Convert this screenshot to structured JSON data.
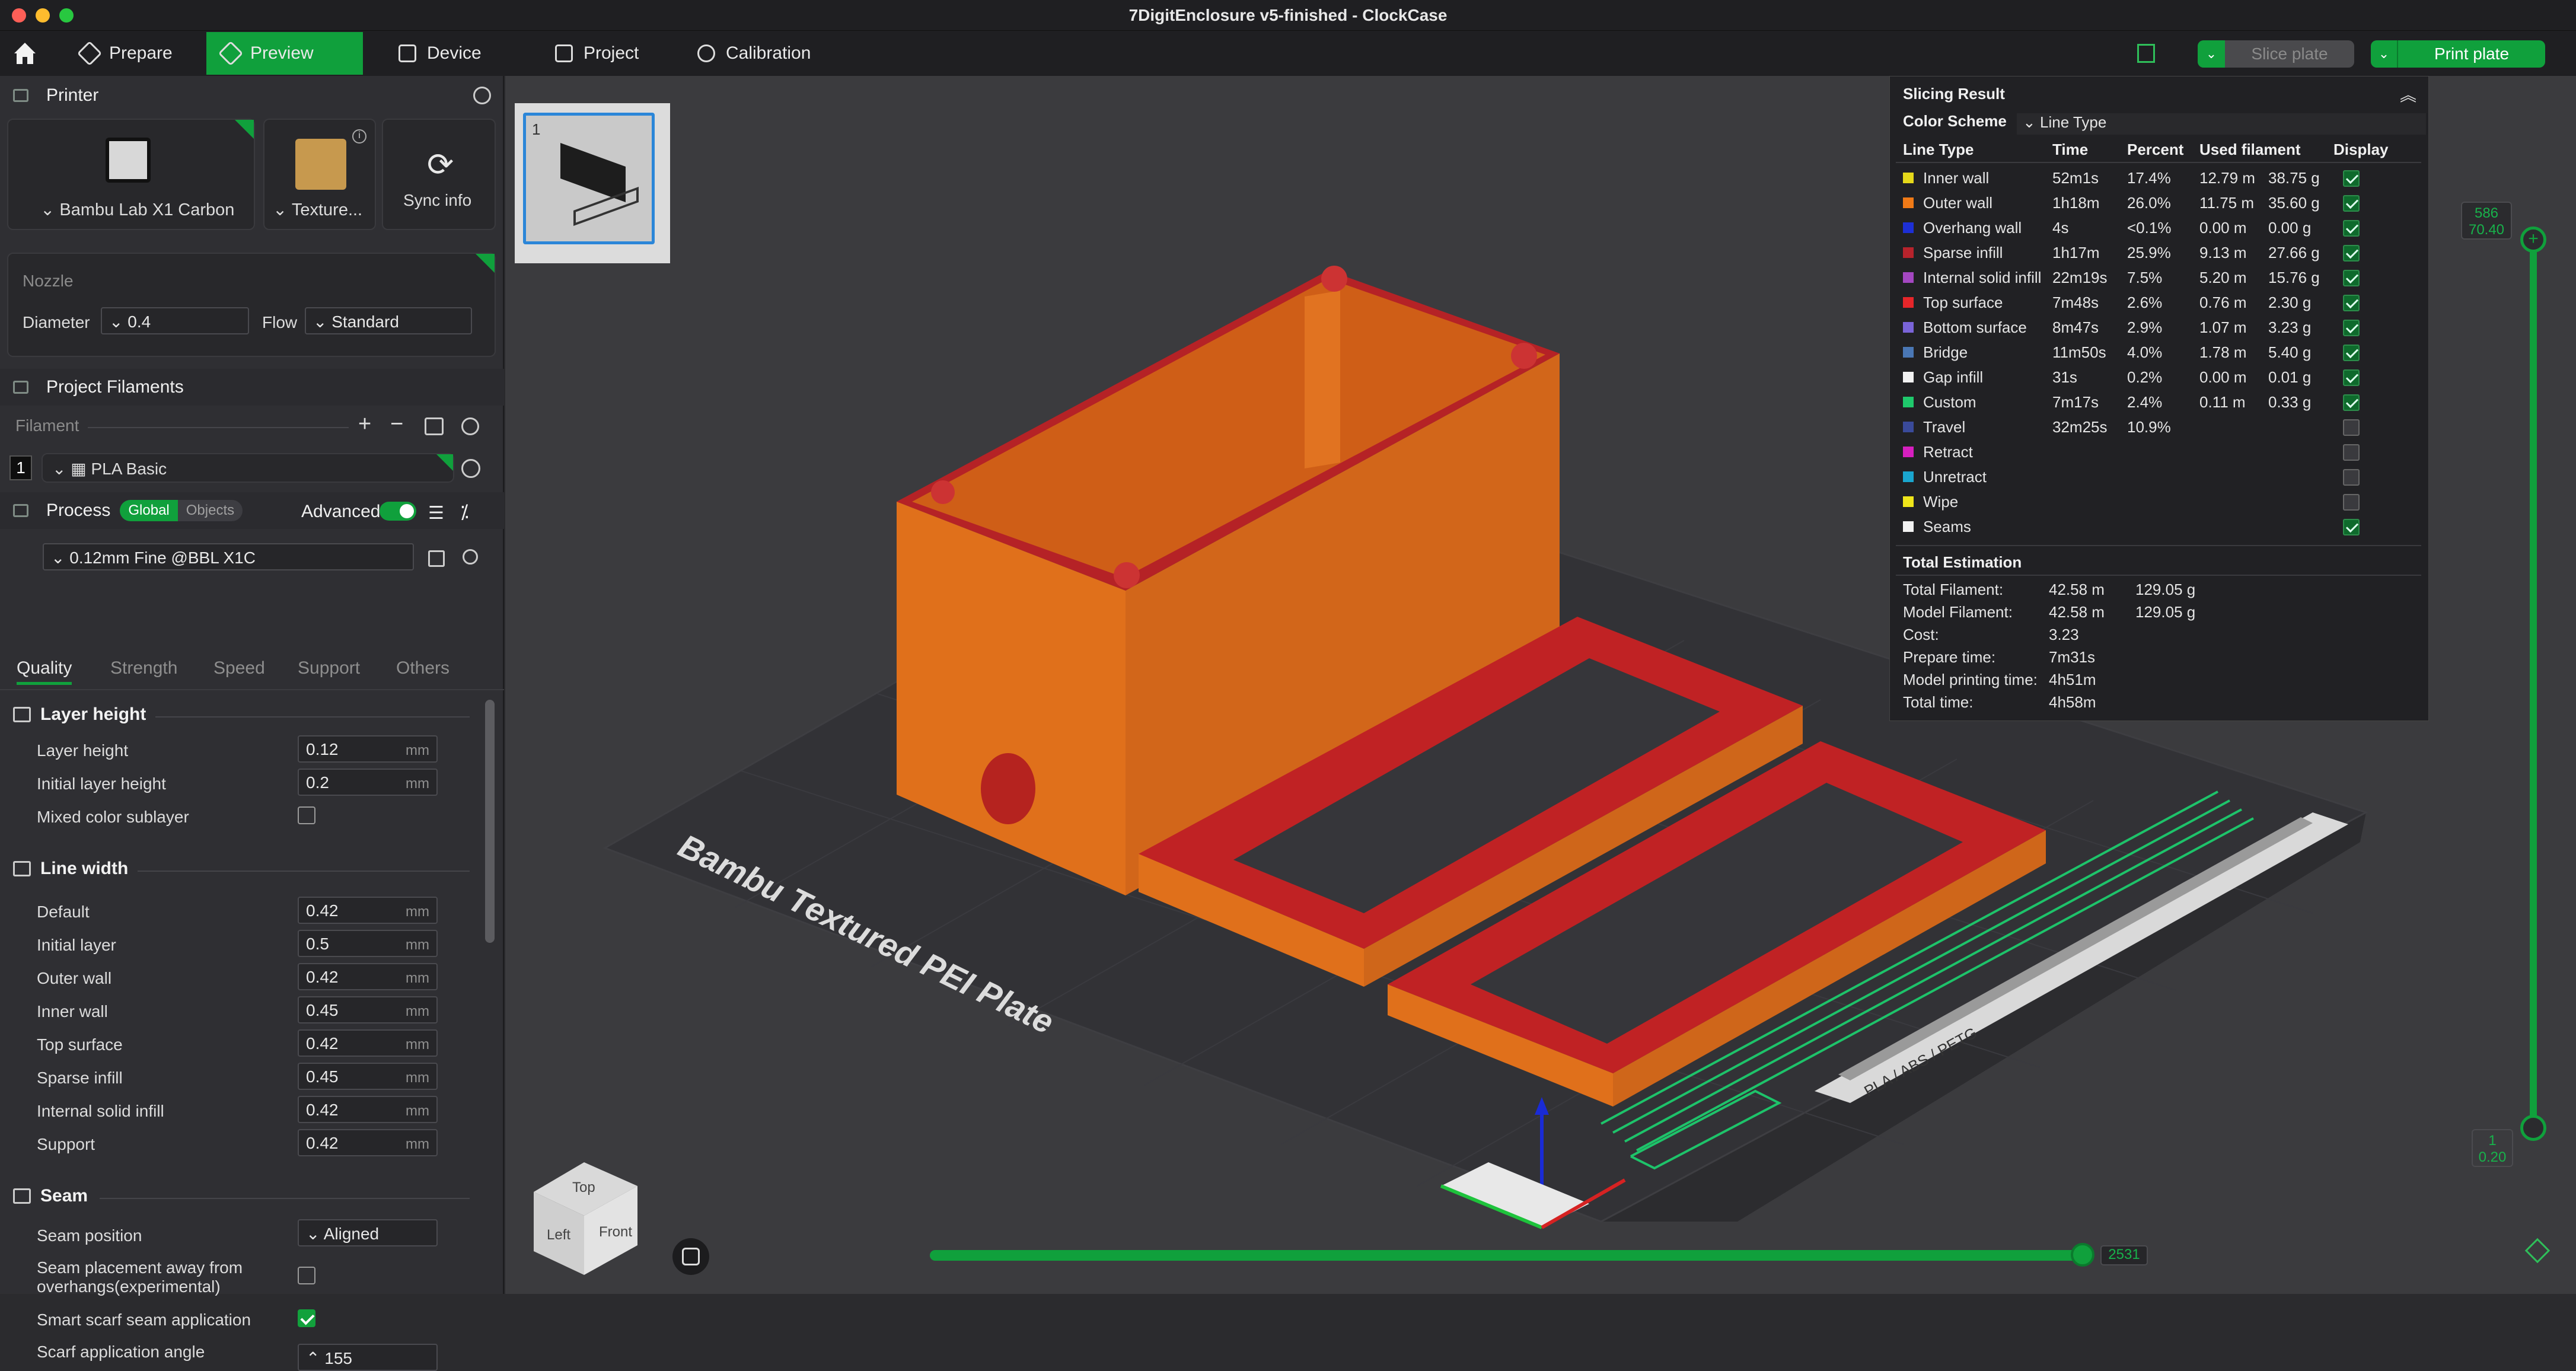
{
  "window": {
    "title": "7DigitEnclosure v5-finished - ClockCase"
  },
  "toolbar": {
    "tabs": [
      {
        "label": "Prepare"
      },
      {
        "label": "Preview"
      },
      {
        "label": "Device"
      },
      {
        "label": "Project"
      },
      {
        "label": "Calibration"
      }
    ],
    "slice_label": "Slice plate",
    "print_label": "Print plate"
  },
  "printer": {
    "section_label": "Printer",
    "printer_name": "Bambu Lab X1 Carbon",
    "plate_name": "Texture...",
    "sync_label": "Sync info",
    "nozzle_label": "Nozzle",
    "diameter_label": "Diameter",
    "diameter_value": "0.4",
    "flow_label": "Flow",
    "flow_value": "Standard"
  },
  "filaments": {
    "section_label": "Project Filaments",
    "filament_label": "Filament",
    "items": [
      {
        "index": "1",
        "name": "PLA Basic"
      }
    ]
  },
  "process": {
    "section_label": "Process",
    "global_label": "Global",
    "objects_label": "Objects",
    "advanced_label": "Advanced",
    "preset": "0.12mm Fine @BBL X1C",
    "tabs": [
      "Quality",
      "Strength",
      "Speed",
      "Support",
      "Others"
    ],
    "groups": {
      "layer_height": {
        "title": "Layer height",
        "rows": [
          {
            "label": "Layer height",
            "value": "0.12",
            "unit": "mm"
          },
          {
            "label": "Initial layer height",
            "value": "0.2",
            "unit": "mm"
          }
        ],
        "mixed_label": "Mixed color sublayer"
      },
      "line_width": {
        "title": "Line width",
        "rows": [
          {
            "label": "Default",
            "value": "0.42",
            "unit": "mm"
          },
          {
            "label": "Initial layer",
            "value": "0.5",
            "unit": "mm"
          },
          {
            "label": "Outer wall",
            "value": "0.42",
            "unit": "mm"
          },
          {
            "label": "Inner wall",
            "value": "0.45",
            "unit": "mm"
          },
          {
            "label": "Top surface",
            "value": "0.42",
            "unit": "mm"
          },
          {
            "label": "Sparse infill",
            "value": "0.45",
            "unit": "mm"
          },
          {
            "label": "Internal solid infill",
            "value": "0.42",
            "unit": "mm"
          },
          {
            "label": "Support",
            "value": "0.42",
            "unit": "mm"
          }
        ]
      },
      "seam": {
        "title": "Seam",
        "position_label": "Seam position",
        "position_value": "Aligned",
        "overhang_label_1": "Seam placement away from",
        "overhang_label_2": "overhangs(experimental)",
        "scarf_label": "Smart scarf seam application",
        "angle_label": "Scarf application angle",
        "angle_value": "155"
      }
    }
  },
  "viewport": {
    "plate_number": "1",
    "bed_label": "Bambu Textured PEI Plate",
    "bed_tag": "PLA / ABS / PETG",
    "top_layer": "586",
    "top_height": "70.40",
    "bottom_layer": "1",
    "bottom_height": "0.20",
    "move_value": "2531",
    "cube_top": "Top",
    "cube_left": "Left",
    "cube_front": "Front"
  },
  "slicing_result": {
    "title": "Slicing Result",
    "color_scheme_label": "Color Scheme",
    "color_scheme_value": "Line Type",
    "headers": [
      "Line Type",
      "Time",
      "Percent",
      "Used filament",
      "Display"
    ],
    "rows": [
      {
        "name": "Inner wall",
        "color": "#e5d81a",
        "time": "52m1s",
        "percent": "17.4%",
        "length": "12.79 m",
        "weight": "38.75 g",
        "display": true
      },
      {
        "name": "Outer wall",
        "color": "#f07a17",
        "time": "1h18m",
        "percent": "26.0%",
        "length": "11.75 m",
        "weight": "35.60 g",
        "display": true
      },
      {
        "name": "Overhang wall",
        "color": "#1d2fd6",
        "time": "4s",
        "percent": "<0.1%",
        "length": "0.00 m",
        "weight": "0.00 g",
        "display": true
      },
      {
        "name": "Sparse infill",
        "color": "#b7232c",
        "time": "1h17m",
        "percent": "25.9%",
        "length": "9.13 m",
        "weight": "27.66 g",
        "display": true
      },
      {
        "name": "Internal solid infill",
        "color": "#a447c1",
        "time": "22m19s",
        "percent": "7.5%",
        "length": "5.20 m",
        "weight": "15.76 g",
        "display": true
      },
      {
        "name": "Top surface",
        "color": "#e6262a",
        "time": "7m48s",
        "percent": "2.6%",
        "length": "0.76 m",
        "weight": "2.30 g",
        "display": true
      },
      {
        "name": "Bottom surface",
        "color": "#7a64d8",
        "time": "8m47s",
        "percent": "2.9%",
        "length": "1.07 m",
        "weight": "3.23 g",
        "display": true
      },
      {
        "name": "Bridge",
        "color": "#4a77b5",
        "time": "11m50s",
        "percent": "4.0%",
        "length": "1.78 m",
        "weight": "5.40 g",
        "display": true
      },
      {
        "name": "Gap infill",
        "color": "#f2f2f2",
        "time": "31s",
        "percent": "0.2%",
        "length": "0.00 m",
        "weight": "0.01 g",
        "display": true
      },
      {
        "name": "Custom",
        "color": "#1fc96c",
        "time": "7m17s",
        "percent": "2.4%",
        "length": "0.11 m",
        "weight": "0.33 g",
        "display": true
      },
      {
        "name": "Travel",
        "color": "#3a4a9a",
        "time": "32m25s",
        "percent": "10.9%",
        "length": "",
        "weight": "",
        "display": false
      },
      {
        "name": "Retract",
        "color": "#d61fbf",
        "time": "",
        "percent": "",
        "length": "",
        "weight": "",
        "display": false
      },
      {
        "name": "Unretract",
        "color": "#1aa6cf",
        "time": "",
        "percent": "",
        "length": "",
        "weight": "",
        "display": false
      },
      {
        "name": "Wipe",
        "color": "#efe51a",
        "time": "",
        "percent": "",
        "length": "",
        "weight": "",
        "display": false
      },
      {
        "name": "Seams",
        "color": "#f2f2f2",
        "time": "",
        "percent": "",
        "length": "",
        "weight": "",
        "display": true
      }
    ],
    "total": {
      "title": "Total Estimation",
      "rows": [
        {
          "label": "Total Filament:",
          "v1": "42.58 m",
          "v2": "129.05 g"
        },
        {
          "label": "Model Filament:",
          "v1": "42.58 m",
          "v2": "129.05 g"
        },
        {
          "label": "Cost:",
          "v1": "3.23",
          "v2": ""
        },
        {
          "label": "Prepare time:",
          "v1": "7m31s",
          "v2": ""
        },
        {
          "label": "Model printing time:",
          "v1": "4h51m",
          "v2": ""
        },
        {
          "label": "Total time:",
          "v1": "4h58m",
          "v2": ""
        }
      ]
    }
  },
  "colors": {
    "accent": "#10a03c",
    "model_orange": "#e5701c",
    "model_red": "#c21f24"
  }
}
